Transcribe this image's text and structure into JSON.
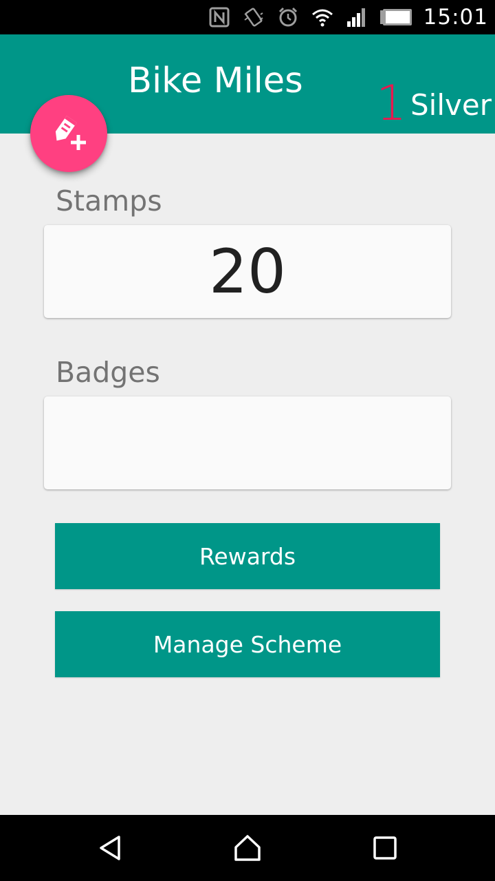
{
  "status_bar": {
    "time": "15:01",
    "icons": [
      "nfc-icon",
      "vibrate-icon",
      "alarm-icon",
      "wifi-icon",
      "signal-icon",
      "battery-icon"
    ]
  },
  "app_bar": {
    "title": "Bike Miles",
    "level_number": "1",
    "level_name": "Silver",
    "color": "#009688"
  },
  "fab": {
    "icon": "edit-tag-add-icon",
    "color": "#ff4081"
  },
  "stamps": {
    "label": "Stamps",
    "value": "20"
  },
  "badges": {
    "label": "Badges"
  },
  "buttons": {
    "rewards": "Rewards",
    "manage_scheme": "Manage Scheme"
  },
  "nav_bar": {
    "icons": [
      "back-icon",
      "home-icon",
      "recents-icon"
    ]
  }
}
